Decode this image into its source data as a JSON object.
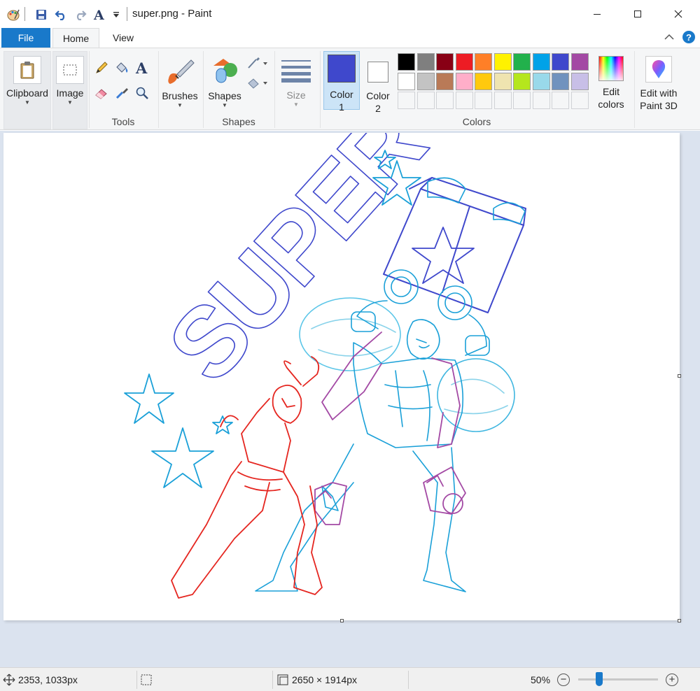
{
  "window": {
    "title": "super.png - Paint"
  },
  "tabs": {
    "file": "File",
    "home": "Home",
    "view": "View"
  },
  "ribbon": {
    "clipboard": "Clipboard",
    "image": "Image",
    "tools_group": "Tools",
    "brushes": "Brushes",
    "shapes": "Shapes",
    "shapes_group": "Shapes",
    "size": "Size",
    "color1_line1": "Color",
    "color1_line2": "1",
    "color2_line1": "Color",
    "color2_line2": "2",
    "colors_group": "Colors",
    "edit_colors_line1": "Edit",
    "edit_colors_line2": "colors",
    "paint3d_line1": "Edit with",
    "paint3d_line2": "Paint 3D"
  },
  "colors": {
    "color1": "#3f48cc",
    "color2": "#ffffff",
    "palette_row1": [
      "#000000",
      "#7f7f7f",
      "#880015",
      "#ed1c24",
      "#ff7f27",
      "#fff200",
      "#22b14c",
      "#00a2e8",
      "#3f48cc",
      "#a349a4"
    ],
    "palette_row2": [
      "#ffffff",
      "#c3c3c3",
      "#b97a57",
      "#ffaec9",
      "#ffc90e",
      "#efe4b0",
      "#b5e61d",
      "#99d9ea",
      "#7092be",
      "#c8bfe7"
    ]
  },
  "canvas": {
    "word": "SUPER"
  },
  "status": {
    "cursor_pos": "2353, 1033px",
    "image_size": "2650 × 1914px",
    "zoom": "50%",
    "zoom_minus": "−",
    "zoom_plus": "+",
    "zoom_level": 0.15
  }
}
